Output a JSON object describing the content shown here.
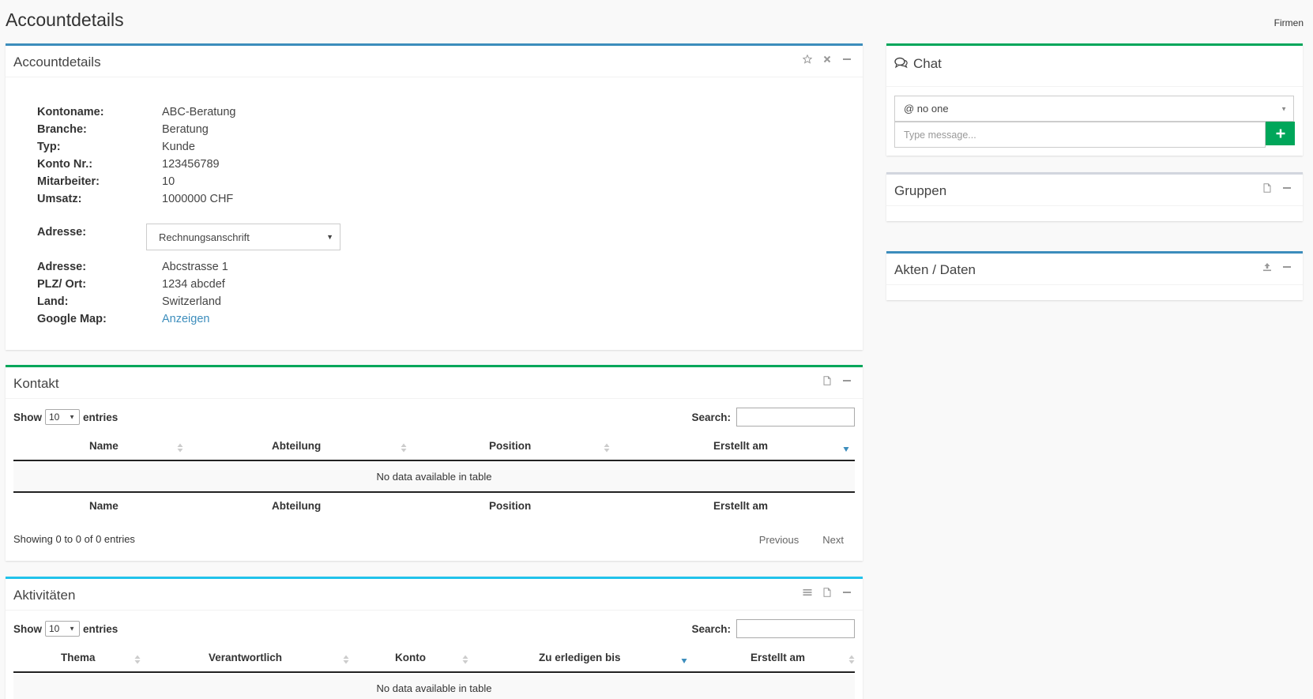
{
  "page": {
    "title": "Accountdetails",
    "breadcrumb": "Firmen"
  },
  "account": {
    "title": "Accountdetails",
    "fields": [
      {
        "label": "Kontoname:",
        "value": "ABC-Beratung"
      },
      {
        "label": "Branche:",
        "value": "Beratung"
      },
      {
        "label": "Typ:",
        "value": "Kunde"
      },
      {
        "label": "Konto Nr.:",
        "value": "123456789"
      },
      {
        "label": "Mitarbeiter:",
        "value": "10"
      },
      {
        "label": "Umsatz:",
        "value": "1000000 CHF"
      }
    ],
    "address_label": "Adresse:",
    "address_select": "Rechnungsanschrift",
    "address_fields": [
      {
        "label": "Adresse:",
        "value": "Abcstrasse 1"
      },
      {
        "label": "PLZ/ Ort:",
        "value": "1234 abcdef"
      },
      {
        "label": "Land:",
        "value": "Switzerland"
      },
      {
        "label": "Google Map:",
        "value": "Anzeigen"
      }
    ]
  },
  "kontakt": {
    "title": "Kontakt",
    "show": "Show",
    "length": "10",
    "entries": "entries",
    "search": "Search:",
    "columns": [
      "Name",
      "Abteilung",
      "Position",
      "Erstellt am"
    ],
    "empty": "No data available in table",
    "info": "Showing 0 to 0 of 0 entries",
    "prev": "Previous",
    "next": "Next"
  },
  "aktivitaeten": {
    "title": "Aktivitäten",
    "show": "Show",
    "length": "10",
    "entries": "entries",
    "search": "Search:",
    "columns": [
      "Thema",
      "Verantwortlich",
      "Konto",
      "Zu erledigen bis",
      "Erstellt am"
    ],
    "empty": "No data available in table"
  },
  "chat": {
    "title": "Chat",
    "recipient": "@ no one",
    "placeholder": "Type message..."
  },
  "gruppen": {
    "title": "Gruppen"
  },
  "akten": {
    "title": "Akten / Daten"
  },
  "colors": {
    "blue": "#3c8dbc",
    "green": "#00a65a",
    "cyan": "#21c3eb",
    "link": "#3c8dbc"
  }
}
